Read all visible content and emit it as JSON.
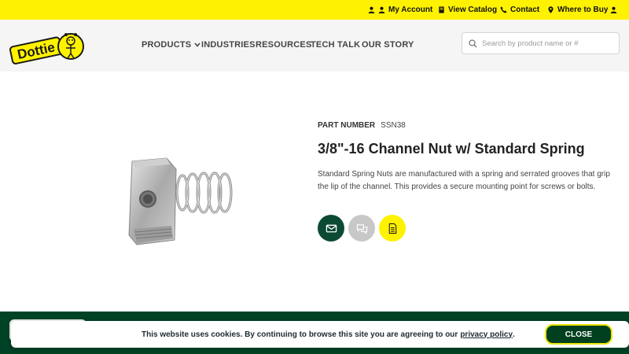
{
  "topbar": {
    "account_label": "My Account",
    "catalog_label": "View Catalog",
    "contact_label": "Contact",
    "where_label": "Where to Buy"
  },
  "logo": {
    "text": "Dottie"
  },
  "nav": {
    "products": "PRODUCTS",
    "industries": "INDUSTRIES",
    "resources": "RESOURCES",
    "techtalk": "TECH TALK",
    "ourstory": "OUR STORY"
  },
  "search": {
    "placeholder": "Search by product name or #",
    "value": ""
  },
  "product": {
    "part_label": "PART NUMBER",
    "part_number": "SSN38",
    "title": "3/8\"-16 Channel Nut w/ Standard Spring",
    "description": "Standard Spring Nuts are manufactured with a spring and serrated grooves that grip the lip of the channel. This provides a secure mounting point for screws or bolts."
  },
  "actions": {
    "colors": {
      "email": "#0c4a34",
      "chat": "#c8c8c8",
      "document": "#fff200"
    }
  },
  "cookie": {
    "text": "This website uses cookies. By continuing to browse this site you are agreeing to our",
    "policy_link": "privacy policy",
    "period": ".",
    "close_label": "CLOSE"
  },
  "colors": {
    "brand_yellow": "#fff200",
    "brand_green": "#004225"
  }
}
